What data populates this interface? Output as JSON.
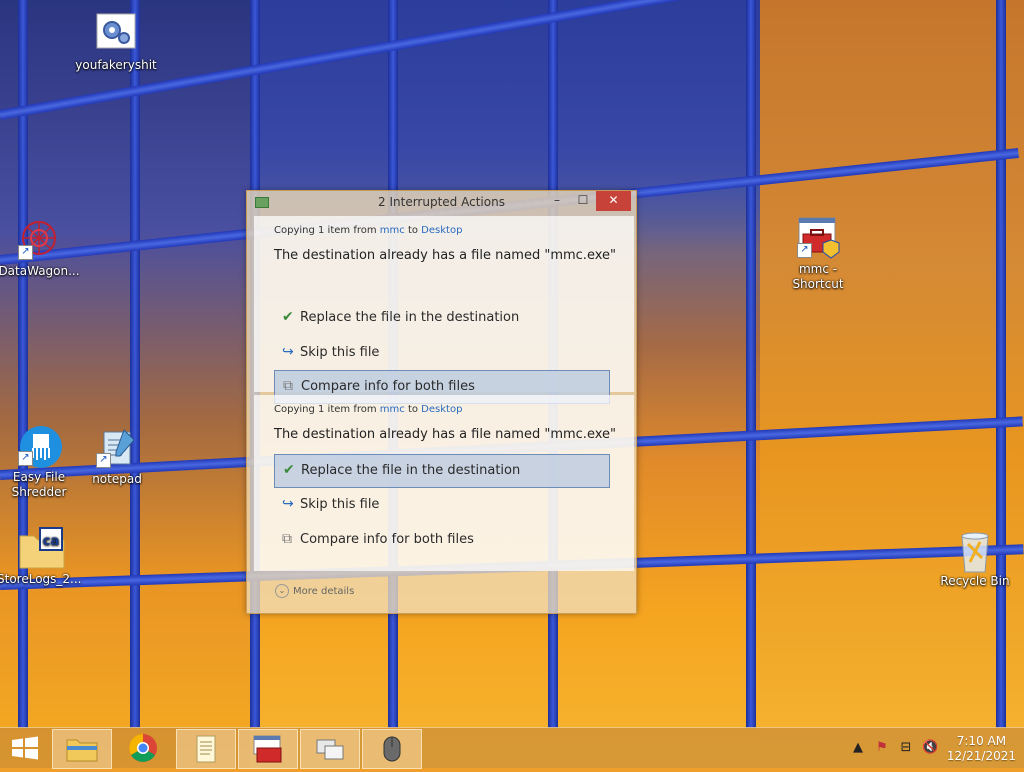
{
  "desktop": {
    "icons": [
      {
        "label": "youfakeryshit"
      },
      {
        "label": "DataWagon..."
      },
      {
        "label": "Easy File Shredder"
      },
      {
        "label": "notepad"
      },
      {
        "label": "StoreLogs_2..."
      },
      {
        "label": "mmc - Shortcut"
      },
      {
        "label": "Recycle Bin"
      }
    ]
  },
  "dialog": {
    "title": "2 Interrupted Actions",
    "minimize": "–",
    "maximize": "☐",
    "close": "✕",
    "conflicts": [
      {
        "copy_prefix": "Copying 1 item from ",
        "source": "mmc",
        "to_word": " to ",
        "destination": "Desktop",
        "message": "The destination already has a file named \"mmc.exe\"",
        "options": {
          "replace": "Replace the file in the destination",
          "skip": "Skip this file",
          "compare": "Compare info for both files"
        }
      },
      {
        "copy_prefix": "Copying 1 item from ",
        "source": "mmc",
        "to_word": " to ",
        "destination": "Desktop",
        "message": "The destination already has a file named \"mmc.exe\"",
        "options": {
          "replace": "Replace the file in the destination",
          "skip": "Skip this file",
          "compare": "Compare info for both files"
        }
      }
    ],
    "more_details": "More details"
  },
  "taskbar": {
    "time": "7:10 AM",
    "date": "12/21/2021"
  },
  "colors": {
    "link": "#2a6bbf",
    "close_button": "#c7433a",
    "check": "#3c8a3c"
  }
}
